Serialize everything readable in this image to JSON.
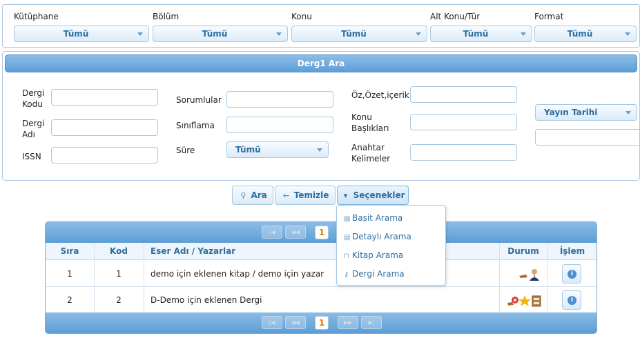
{
  "filters": [
    {
      "label": "Kütüphane",
      "value": "Tümü"
    },
    {
      "label": "Bölüm",
      "value": "Tümü"
    },
    {
      "label": "Konu",
      "value": "Tümü"
    },
    {
      "label": "Alt Konu/Tür",
      "value": "Tümü"
    },
    {
      "label": "Format",
      "value": "Tümü"
    }
  ],
  "panel": {
    "title": "Derg1 Ara",
    "fields": {
      "dergi_kodu": "Dergi Kodu",
      "dergi_adi": "Dergi Adı",
      "issn": "ISSN",
      "sorumlular": "Sorumlular",
      "siniflama": "Sınıflama",
      "sure": "Süre",
      "ozet": "Öz,Özet,içerik",
      "konu_basliklari": "Konu Başlıkları",
      "anahtar": "Anahtar Kelimeler"
    },
    "sure_value": "Tümü",
    "yayin_tarihi": "Yayın Tarihi"
  },
  "buttons": {
    "ara": "Ara",
    "temizle": "Temizle",
    "secenekler": "Seçenekler"
  },
  "menu": [
    {
      "label": "Basit Arama",
      "icon": "list-icon"
    },
    {
      "label": "Detaylı Arama",
      "icon": "list-icon"
    },
    {
      "label": "Kitap Arama",
      "icon": "lock-icon"
    },
    {
      "label": "Dergi Arama",
      "icon": "key-icon"
    }
  ],
  "grid": {
    "page": "1",
    "columns": [
      "Sıra",
      "Kod",
      "Eser Adı / Yazarlar",
      "Durum",
      "İşlem"
    ],
    "rows": [
      {
        "sira": "1",
        "kod": "1",
        "eser": "demo için eklenen kitap / demo için yazar"
      },
      {
        "sira": "2",
        "kod": "2",
        "eser": "D-Demo için eklenen Dergi"
      }
    ]
  },
  "colors": {
    "accent": "#2e6e9e",
    "header": "#5e9fd6",
    "page_number": "#e07a00"
  }
}
